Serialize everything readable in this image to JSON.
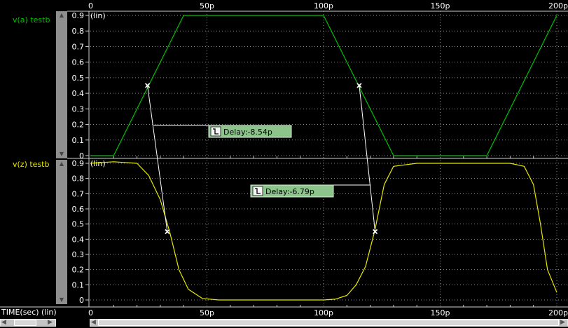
{
  "traces": [
    {
      "name": "v(a) testb",
      "color": "#00c400",
      "ylabel": "(lin)",
      "yticks": [
        "0.9",
        "0.8",
        "0.7",
        "0.6",
        "0.5",
        "0.4",
        "0.3",
        "0.2",
        "0.1",
        "0"
      ]
    },
    {
      "name": "v(z) testb",
      "color": "#e8e800",
      "ylabel": "(lin)",
      "yticks": [
        "0.9",
        "0.8",
        "0.7",
        "0.6",
        "0.5",
        "0.4",
        "0.3",
        "0.2",
        "0.1",
        "0"
      ]
    }
  ],
  "xticks": [
    "0",
    "50p",
    "100p",
    "150p",
    "200p"
  ],
  "x_axis_label": "TIME(sec) (lin)",
  "measurements": [
    {
      "label": "Delay:-8.54p"
    },
    {
      "label": "Delay:-6.79p"
    }
  ],
  "chart_data": [
    {
      "type": "line",
      "title": "v(a) testb",
      "xlabel": "TIME(sec) (lin)",
      "ylabel": "(lin)",
      "xlim_ps": [
        0,
        200
      ],
      "ylim": [
        0,
        0.95
      ],
      "series": [
        {
          "name": "v(a) testb",
          "x_ps": [
            0,
            10,
            40,
            100,
            130,
            170,
            200
          ],
          "y": [
            0,
            0,
            0.9,
            0.9,
            0,
            0,
            0.9
          ]
        }
      ]
    },
    {
      "type": "line",
      "title": "v(z) testb",
      "xlabel": "TIME(sec) (lin)",
      "ylabel": "(lin)",
      "xlim_ps": [
        0,
        200
      ],
      "ylim": [
        0,
        0.95
      ],
      "series": [
        {
          "name": "v(z) testb",
          "x_ps": [
            0,
            10,
            20,
            25,
            30,
            34,
            38,
            42,
            48,
            55,
            60,
            90,
            100,
            105,
            110,
            114,
            118,
            122,
            126,
            130,
            140,
            170,
            180,
            186,
            190,
            193,
            196,
            200
          ],
          "y": [
            0.9,
            0.91,
            0.9,
            0.82,
            0.66,
            0.45,
            0.2,
            0.07,
            0.01,
            0,
            0,
            0,
            0,
            0.005,
            0.03,
            0.1,
            0.22,
            0.46,
            0.76,
            0.88,
            0.9,
            0.9,
            0.9,
            0.88,
            0.76,
            0.5,
            0.2,
            0.05
          ]
        }
      ]
    }
  ],
  "delay_markers": [
    {
      "from": {
        "trace": 0,
        "x_ps": 24.5,
        "y": 0.45
      },
      "to": {
        "trace": 1,
        "x_ps": 33.0,
        "y": 0.45
      },
      "label_index": 0
    },
    {
      "from": {
        "trace": 0,
        "x_ps": 115.3,
        "y": 0.45
      },
      "to": {
        "trace": 1,
        "x_ps": 122.1,
        "y": 0.45
      },
      "label_index": 1
    }
  ]
}
